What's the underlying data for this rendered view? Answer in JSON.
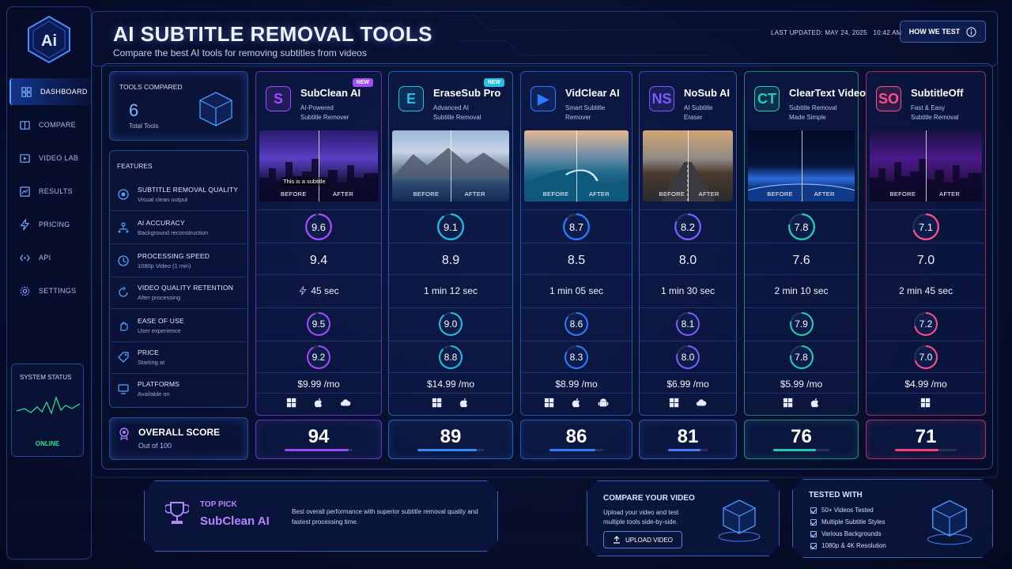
{
  "app": {
    "logo_text": "Ai"
  },
  "header": {
    "title": "AI SUBTITLE REMOVAL TOOLS",
    "subtitle": "Compare the best AI tools for removing subtitles from videos",
    "last_updated": "LAST UPDATED: MAY 24, 2025   10:42 AM",
    "how_button": "HOW WE TEST"
  },
  "sidebar": {
    "items": [
      {
        "label": "DASHBOARD",
        "icon": "dashboard-icon",
        "active": true
      },
      {
        "label": "COMPARE",
        "icon": "compare-icon",
        "active": false
      },
      {
        "label": "VIDEO LAB",
        "icon": "video-lab-icon",
        "active": false
      },
      {
        "label": "RESULTS",
        "icon": "results-icon",
        "active": false
      },
      {
        "label": "PRICING",
        "icon": "lightning-icon",
        "active": false
      },
      {
        "label": "API",
        "icon": "api-icon",
        "active": false
      },
      {
        "label": "SETTINGS",
        "icon": "gear-icon",
        "active": false
      }
    ],
    "system_status": {
      "label": "SYSTEM STATUS",
      "state": "ONLINE"
    }
  },
  "summary": {
    "label": "TOOLS COMPARED",
    "count": "6",
    "sub": "Total Tools"
  },
  "features": {
    "heading": "FEATURES",
    "rows": [
      {
        "name": "SUBTITLE REMOVAL QUALITY",
        "desc": "Visual clean output",
        "icon": "quality-icon"
      },
      {
        "name": "AI ACCURACY",
        "desc": "Background reconstruction",
        "icon": "ai-accuracy-icon"
      },
      {
        "name": "PROCESSING SPEED",
        "desc": "1080p Video (1 min)",
        "icon": "clock-icon"
      },
      {
        "name": "VIDEO QUALITY RETENTION",
        "desc": "After processing",
        "icon": "retention-icon"
      },
      {
        "name": "EASE OF USE",
        "desc": "User experience",
        "icon": "hand-icon"
      },
      {
        "name": "PRICE",
        "desc": "Starting at",
        "icon": "tag-icon"
      },
      {
        "name": "PLATFORMS",
        "desc": "Available on",
        "icon": "platforms-icon"
      }
    ],
    "overall": {
      "name": "OVERALL SCORE",
      "desc": "Out of 100"
    }
  },
  "tools": [
    {
      "name": "SubClean AI",
      "logo": "S",
      "desc1": "AI-Powered",
      "desc2": "Subtitle Remover",
      "badge": "NEW",
      "color": "#a24cff",
      "accent": "#8f4dff",
      "quality": "9.6",
      "accuracy": "9.4",
      "speed": "45 sec",
      "retention": "9.5",
      "ease": "9.2",
      "price": "$9.99 /mo",
      "platforms": [
        "windows-icon",
        "apple-icon",
        "cloud-icon"
      ],
      "overall": "94",
      "overall_value": 94,
      "subtitle_text": "This is a subtitle",
      "before": "BEFORE",
      "after": "AFTER",
      "scene": "city"
    },
    {
      "name": "EraseSub Pro",
      "logo": "E",
      "desc1": "Advanced AI",
      "desc2": "Subtitle Removal",
      "badge": "NEW",
      "color": "#1ec0e6",
      "accent": "#2f8dff",
      "quality": "9.1",
      "accuracy": "8.9",
      "speed": "1 min 12 sec",
      "retention": "9.0",
      "ease": "8.8",
      "price": "$14.99 /mo",
      "platforms": [
        "windows-icon",
        "apple-icon"
      ],
      "overall": "89",
      "overall_value": 89,
      "subtitle_text": "",
      "before": "BEFORE",
      "after": "AFTER",
      "scene": "mountain"
    },
    {
      "name": "VidClear AI",
      "logo": "▶",
      "desc1": "Smart Subtitle",
      "desc2": "Remover",
      "badge": "",
      "color": "#2f7bff",
      "accent": "#2f7bff",
      "quality": "8.7",
      "accuracy": "8.5",
      "speed": "1 min 05 sec",
      "retention": "8.6",
      "ease": "8.3",
      "price": "$8.99 /mo",
      "platforms": [
        "windows-icon",
        "apple-icon",
        "android-icon"
      ],
      "overall": "86",
      "overall_value": 86,
      "subtitle_text": "",
      "before": "BEFORE",
      "after": "AFTER",
      "scene": "wave"
    },
    {
      "name": "NoSub AI",
      "logo": "NS",
      "desc1": "AI Subtitle",
      "desc2": "Eraser",
      "badge": "",
      "color": "#7a5cff",
      "accent": "#4a7cff",
      "quality": "8.2",
      "accuracy": "8.0",
      "speed": "1 min 30 sec",
      "retention": "8.1",
      "ease": "8.0",
      "price": "$6.99 /mo",
      "platforms": [
        "windows-icon",
        "cloud-icon"
      ],
      "overall": "81",
      "overall_value": 81,
      "subtitle_text": "",
      "before": "BEFORE",
      "after": "AFTER",
      "scene": "road"
    },
    {
      "name": "ClearText Video",
      "logo": "CT",
      "desc1": "Subtitle Removal",
      "desc2": "Made Simple",
      "badge": "",
      "color": "#1fd1b0",
      "accent": "#22c9b0",
      "quality": "7.8",
      "accuracy": "7.6",
      "speed": "2 min 10 sec",
      "retention": "7.9",
      "ease": "7.8",
      "price": "$5.99 /mo",
      "platforms": [
        "windows-icon",
        "apple-icon"
      ],
      "overall": "76",
      "overall_value": 76,
      "subtitle_text": "",
      "before": "BEFORE",
      "after": "AFTER",
      "scene": "earth"
    },
    {
      "name": "SubtitleOff",
      "logo": "SO",
      "desc1": "Fast & Easy",
      "desc2": "Subtitle Removal",
      "badge": "",
      "color": "#ff4f8a",
      "accent": "#ff3f78",
      "quality": "7.1",
      "accuracy": "7.0",
      "speed": "2 min 45 sec",
      "retention": "7.2",
      "ease": "7.0",
      "price": "$4.99 /mo",
      "platforms": [
        "windows-icon"
      ],
      "overall": "71",
      "overall_value": 71,
      "subtitle_text": "",
      "before": "BEFORE",
      "after": "AFTER",
      "scene": "neon"
    }
  ],
  "top_pick": {
    "label": "TOP PICK",
    "name": "SubClean AI",
    "text": "Best overall performance with superior subtitle removal quality and fastest processing time."
  },
  "compare_video": {
    "title": "COMPARE YOUR VIDEO",
    "text": "Upload your video and test multiple tools side-by-side.",
    "button": "UPLOAD VIDEO"
  },
  "tested_with": {
    "title": "TESTED WITH",
    "items": [
      "50+ Videos Tested",
      "Multiple Subtitle Styles",
      "Various Backgrounds",
      "1080p & 4K Resolution"
    ]
  }
}
